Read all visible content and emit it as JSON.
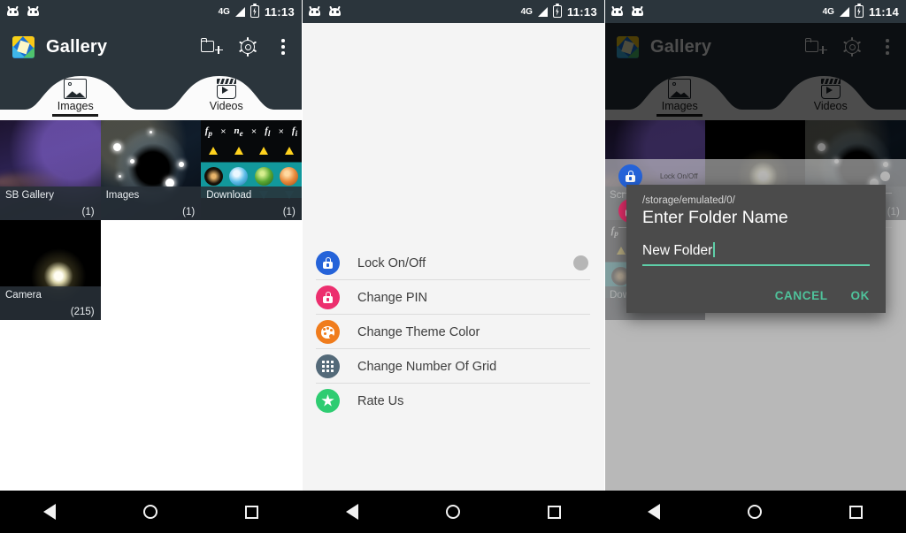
{
  "status_bar": {
    "time_left": "11:13",
    "time_right": "11:14",
    "network": "4G",
    "icons": [
      "robot-icon",
      "robot-icon",
      "signal-icon",
      "battery-charging-icon"
    ]
  },
  "app": {
    "title": "Gallery",
    "icon": "gallery-app-icon",
    "actions": [
      {
        "name": "new-folder-icon",
        "label": "New Folder"
      },
      {
        "name": "settings-gear-icon",
        "label": "Settings"
      },
      {
        "name": "overflow-menu-icon",
        "label": "More options"
      }
    ]
  },
  "tabs": [
    {
      "label": "Images",
      "icon": "image-icon",
      "selected": true
    },
    {
      "label": "Videos",
      "icon": "video-icon",
      "selected": false
    }
  ],
  "gallery": {
    "items": [
      {
        "name": "SB Gallery",
        "count": "(1)",
        "thumb": "purple-room"
      },
      {
        "name": "Images",
        "count": "(1)",
        "thumb": "black-hole"
      },
      {
        "name": "Download",
        "count": "(1)",
        "thumb": "drake-equation"
      },
      {
        "name": "Camera",
        "count": "(215)",
        "thumb": "moon-night"
      }
    ]
  },
  "drake_thumb": {
    "terms": [
      "f",
      "×",
      "n",
      "×",
      "f",
      "×",
      "f"
    ]
  },
  "settings": {
    "items": [
      {
        "label": "Lock On/Off",
        "icon": "lock-icon",
        "color": "#2563d9",
        "has_toggle": true,
        "toggle_on": false
      },
      {
        "label": "Change PIN",
        "icon": "lock-pin-icon",
        "color": "#ec2f6e",
        "has_toggle": false
      },
      {
        "label": "Change Theme Color",
        "icon": "palette-icon",
        "color": "#f07c1c",
        "has_toggle": false
      },
      {
        "label": "Change Number Of Grid",
        "icon": "grid-icon",
        "color": "#546a79",
        "has_toggle": false
      },
      {
        "label": "Rate Us",
        "icon": "star-icon",
        "color": "#2ecc71",
        "has_toggle": false
      }
    ]
  },
  "dialog": {
    "path": "/storage/emulated/0/",
    "title": "Enter Folder Name",
    "input_value": "New Folder",
    "cancel_label": "CANCEL",
    "ok_label": "OK",
    "accent": "#5ecfa8"
  },
  "nav_bar": {
    "buttons": [
      "back-button",
      "home-button",
      "recents-button"
    ]
  },
  "partial_labels": {
    "scr": "Scr",
    "dow": "Dow",
    "lock_small": "Lock On/Off"
  }
}
